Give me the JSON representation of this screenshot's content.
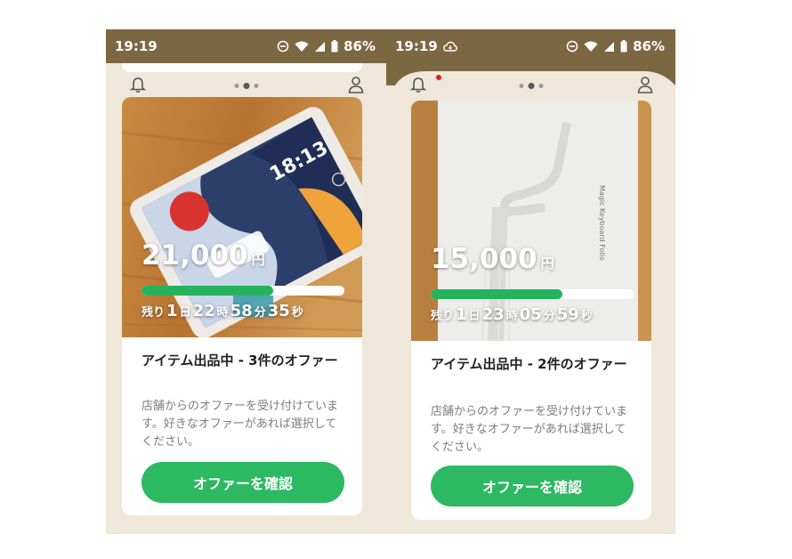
{
  "colors": {
    "status_bar": "#7b6843",
    "background": "#efe7d9",
    "accent": "#2db862",
    "progress": "#26b25d"
  },
  "screens": [
    {
      "status": {
        "time": "19:19",
        "battery": "86%"
      },
      "card": {
        "price": "21,000",
        "currency": "円",
        "progress": 0.65,
        "countdown": {
          "prefix": "残り",
          "days": "1",
          "days_unit": "日",
          "hours": "22",
          "hours_unit": "時",
          "minutes": "58",
          "minutes_unit": "分",
          "seconds": "35",
          "seconds_unit": "秒"
        },
        "title": "アイテム出品中 - 3件のオファー",
        "description": "店舗からのオファーを受け付けています。好きなオファーがあれば選択してください。",
        "button": "オファーを確認"
      }
    },
    {
      "status": {
        "time": "19:19",
        "battery": "86%"
      },
      "card": {
        "price": "15,000",
        "currency": "円",
        "progress": 0.65,
        "countdown": {
          "prefix": "残り",
          "days": "1",
          "days_unit": "日",
          "hours": "23",
          "hours_unit": "時",
          "minutes": "05",
          "minutes_unit": "分",
          "seconds": "59",
          "seconds_unit": "秒"
        },
        "title": "アイテム出品中 - 2件のオファー",
        "description": "店舗からのオファーを受け付けています。好きなオファーがあれば選択してください。",
        "button": "オファーを確認",
        "photo_text": "Magic Keyboard Folio"
      }
    }
  ]
}
